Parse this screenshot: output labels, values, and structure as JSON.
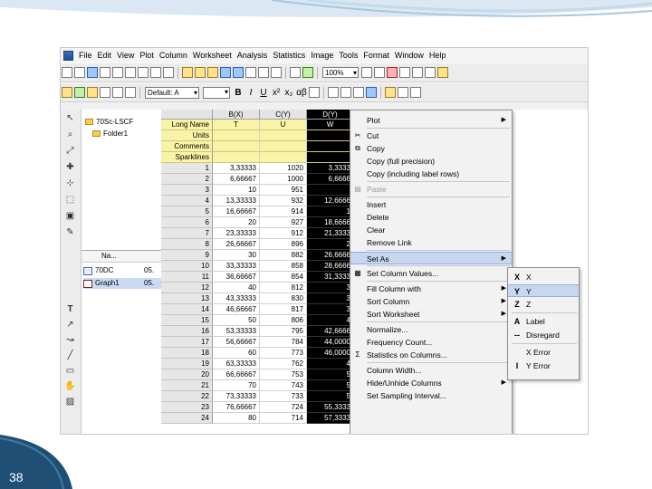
{
  "slide": {
    "page_number": "38"
  },
  "menubar": {
    "items": [
      "File",
      "Edit",
      "View",
      "Plot",
      "Column",
      "Worksheet",
      "Analysis",
      "Statistics",
      "Image",
      "Tools",
      "Format",
      "Window",
      "Help"
    ]
  },
  "toolbar": {
    "zoom_value": "100%",
    "font_name": "Default: A"
  },
  "explorer": {
    "root_label": "70Sc-LSCF",
    "folder_label": "Folder1",
    "header_name": "Na...",
    "items": [
      {
        "name": "70DC",
        "extra": "05."
      },
      {
        "name": "Graph1",
        "extra": "05."
      }
    ]
  },
  "worksheet": {
    "col_headers": [
      "B(X)",
      "C(Y)",
      "D(Y)"
    ],
    "meta_rows": [
      {
        "label": "Long Name",
        "values": [
          "T",
          "U",
          "W"
        ]
      },
      {
        "label": "Units",
        "values": [
          "",
          "",
          ""
        ]
      },
      {
        "label": "Comments",
        "values": [
          "",
          "",
          ""
        ]
      },
      {
        "label": "Sparklines",
        "values": [
          "",
          "",
          ""
        ]
      }
    ],
    "rows": [
      {
        "n": "1",
        "b": "3,33333",
        "c": "1020",
        "d": "3,3333"
      },
      {
        "n": "2",
        "b": "6,66667",
        "c": "1000",
        "d": "6,6666"
      },
      {
        "n": "3",
        "b": "10",
        "c": "951",
        "d": ""
      },
      {
        "n": "4",
        "b": "13,33333",
        "c": "932",
        "d": "12,6666"
      },
      {
        "n": "5",
        "b": "16,66667",
        "c": "914",
        "d": "1"
      },
      {
        "n": "6",
        "b": "20",
        "c": "927",
        "d": "18,6666"
      },
      {
        "n": "7",
        "b": "23,33333",
        "c": "912",
        "d": "21,3333"
      },
      {
        "n": "8",
        "b": "26,66667",
        "c": "896",
        "d": "2"
      },
      {
        "n": "9",
        "b": "30",
        "c": "882",
        "d": "26,6666"
      },
      {
        "n": "10",
        "b": "33,33333",
        "c": "858",
        "d": "28,6666"
      },
      {
        "n": "11",
        "b": "36,66667",
        "c": "854",
        "d": "31,3333"
      },
      {
        "n": "12",
        "b": "40",
        "c": "812",
        "d": "3"
      },
      {
        "n": "13",
        "b": "43,33333",
        "c": "830",
        "d": "3"
      },
      {
        "n": "14",
        "b": "46,66667",
        "c": "817",
        "d": "3"
      },
      {
        "n": "15",
        "b": "50",
        "c": "806",
        "d": "4"
      },
      {
        "n": "16",
        "b": "53,33333",
        "c": "795",
        "d": "42,6666"
      },
      {
        "n": "17",
        "b": "56,66667",
        "c": "784",
        "d": "44,0000"
      },
      {
        "n": "18",
        "b": "60",
        "c": "773",
        "d": "46,0000"
      },
      {
        "n": "19",
        "b": "63,33333",
        "c": "762",
        "d": "4"
      },
      {
        "n": "20",
        "b": "66,66667",
        "c": "753",
        "d": "5"
      },
      {
        "n": "21",
        "b": "70",
        "c": "743",
        "d": "5"
      },
      {
        "n": "22",
        "b": "73,33333",
        "c": "733",
        "d": "5"
      },
      {
        "n": "23",
        "b": "76,66667",
        "c": "724",
        "d": "55,3333"
      },
      {
        "n": "24",
        "b": "80",
        "c": "714",
        "d": "57,3333"
      }
    ]
  },
  "context_menu": {
    "items": [
      {
        "label": "Plot",
        "arrow": true,
        "icon": "",
        "disabled": false,
        "highlighted": false
      },
      {
        "label": "Cut",
        "arrow": false,
        "icon": "cut-icon",
        "disabled": false,
        "highlighted": false
      },
      {
        "label": "Copy",
        "arrow": false,
        "icon": "copy-icon",
        "disabled": false,
        "highlighted": false
      },
      {
        "label": "Copy (full precision)",
        "arrow": false,
        "icon": "",
        "disabled": false,
        "highlighted": false
      },
      {
        "label": "Copy (including label rows)",
        "arrow": false,
        "icon": "",
        "disabled": false,
        "highlighted": false
      },
      {
        "label": "Paste",
        "arrow": false,
        "icon": "paste-icon",
        "disabled": true,
        "highlighted": false
      },
      {
        "label": "Insert",
        "arrow": false,
        "icon": "",
        "disabled": false,
        "highlighted": false
      },
      {
        "label": "Delete",
        "arrow": false,
        "icon": "",
        "disabled": false,
        "highlighted": false
      },
      {
        "label": "Clear",
        "arrow": false,
        "icon": "",
        "disabled": false,
        "highlighted": false
      },
      {
        "label": "Remove Link",
        "arrow": false,
        "icon": "",
        "disabled": false,
        "highlighted": false
      },
      {
        "label": "Set As",
        "arrow": true,
        "icon": "",
        "disabled": false,
        "highlighted": true
      },
      {
        "label": "Set Column Values...",
        "arrow": false,
        "icon": "set-values-icon",
        "disabled": false,
        "highlighted": false
      },
      {
        "label": "Fill Column with",
        "arrow": true,
        "icon": "",
        "disabled": false,
        "highlighted": false
      },
      {
        "label": "Sort Column",
        "arrow": true,
        "icon": "",
        "disabled": false,
        "highlighted": false
      },
      {
        "label": "Sort Worksheet",
        "arrow": true,
        "icon": "",
        "disabled": false,
        "highlighted": false
      },
      {
        "label": "Normalize...",
        "arrow": false,
        "icon": "",
        "disabled": false,
        "highlighted": false
      },
      {
        "label": "Frequency Count...",
        "arrow": false,
        "icon": "",
        "disabled": false,
        "highlighted": false
      },
      {
        "label": "Statistics on Columns...",
        "arrow": false,
        "icon": "statistics-icon",
        "disabled": false,
        "highlighted": false
      },
      {
        "label": "Column Width...",
        "arrow": false,
        "icon": "",
        "disabled": false,
        "highlighted": false
      },
      {
        "label": "Hide/Unhide Columns",
        "arrow": true,
        "icon": "",
        "disabled": false,
        "highlighted": false
      },
      {
        "label": "Set Sampling Interval...",
        "arrow": false,
        "icon": "",
        "disabled": false,
        "highlighted": false
      }
    ]
  },
  "submenu": {
    "items": [
      {
        "label": "X",
        "icon": "X",
        "highlighted": false
      },
      {
        "label": "Y",
        "icon": "Y",
        "highlighted": true
      },
      {
        "label": "Z",
        "icon": "Z",
        "highlighted": false
      },
      {
        "label": "Label",
        "icon": "A",
        "highlighted": false
      },
      {
        "label": "Disregard",
        "icon": "--",
        "highlighted": false
      },
      {
        "label": "X Error",
        "icon": "",
        "highlighted": false
      },
      {
        "label": "Y Error",
        "icon": "I",
        "highlighted": false
      }
    ]
  }
}
